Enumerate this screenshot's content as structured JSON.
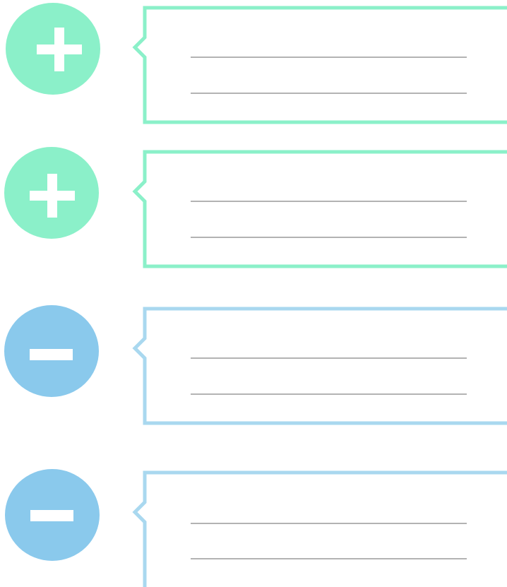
{
  "colors": {
    "plus": "#8bf0c9",
    "minus": "#8ac9ec",
    "plus_border": "#8bf0c9",
    "minus_border": "#a9d8ef",
    "rule_line": "#b3b3b3",
    "glyph": "#ffffff"
  },
  "items": [
    {
      "icon": "plus-icon",
      "kind": "plus"
    },
    {
      "icon": "plus-icon",
      "kind": "plus"
    },
    {
      "icon": "minus-icon",
      "kind": "minus"
    },
    {
      "icon": "minus-icon",
      "kind": "minus"
    }
  ]
}
